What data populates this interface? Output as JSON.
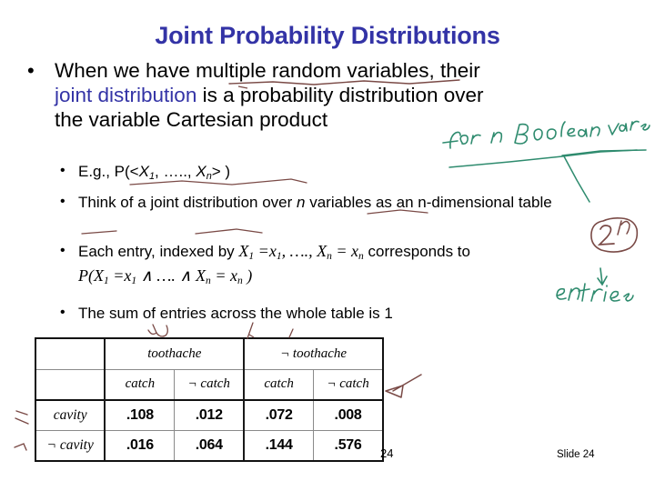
{
  "slide": {
    "title": "Joint Probability Distributions",
    "slide_number_label": "Slide 24",
    "page_number_label": "24"
  },
  "main_bullet": {
    "bullet_glyph": "•",
    "part1": "When we have ",
    "underlined_phrase": "multiple random variables",
    "part2": ", their ",
    "highlight": "joint distribution",
    "part3": " is a probability distribution over the variable Cartesian product"
  },
  "sub_bullets": [
    {
      "glyph": "•",
      "id": "eg",
      "prefix": "E.g., P(<",
      "var1": "X",
      "sub1": "1",
      "middle": ", ….., ",
      "var2": "X",
      "sub2": "n",
      "suffix": "> )"
    },
    {
      "glyph": "•",
      "id": "think",
      "text_a": "Think of a joint distribution over ",
      "var_n": "n",
      "text_b": " variables as an n-dimensional table"
    },
    {
      "glyph": "•",
      "id": "entry",
      "lead": "Each entry, indexed by ",
      "index_expr": "X1 =x1, …., Xn = xn",
      "tail": "  corresponds to",
      "formula": "P(X1 =x1 ∧ …. ∧ Xn = xn )"
    },
    {
      "glyph": "•",
      "id": "sum",
      "text": "The sum of entries across the whole table is 1"
    }
  ],
  "table": {
    "col_group_headers": [
      "toothache",
      "¬ toothache"
    ],
    "sub_headers": [
      "catch",
      "¬ catch",
      "catch",
      "¬ catch"
    ],
    "row_labels": [
      "cavity",
      "¬ cavity"
    ],
    "rows": [
      [
        ".108",
        ".012",
        ".072",
        ".008"
      ],
      [
        ".016",
        ".064",
        ".144",
        ".576"
      ]
    ]
  },
  "annotations": {
    "green_note_top": "for n Boolean vars",
    "green_note_entries": "entries",
    "brown_circle_expr": "2ⁿ"
  },
  "colors": {
    "title": "#3333a6",
    "highlight": "#3333a6",
    "ink_green": "#2e8b6e",
    "ink_brown": "#7a4a46",
    "text": "#000000"
  },
  "chart_data": {
    "type": "table",
    "title": "Joint distribution over Cavity, Toothache, Catch",
    "row_variable": "cavity",
    "column_variables": [
      "toothache",
      "catch"
    ],
    "categories": [
      "toothache ∧ catch",
      "toothache ∧ ¬catch",
      "¬toothache ∧ catch",
      "¬toothache ∧ ¬catch"
    ],
    "series": [
      {
        "name": "cavity",
        "values": [
          0.108,
          0.012,
          0.072,
          0.008
        ]
      },
      {
        "name": "¬ cavity",
        "values": [
          0.016,
          0.064,
          0.144,
          0.576
        ]
      }
    ],
    "total": 1.0
  }
}
